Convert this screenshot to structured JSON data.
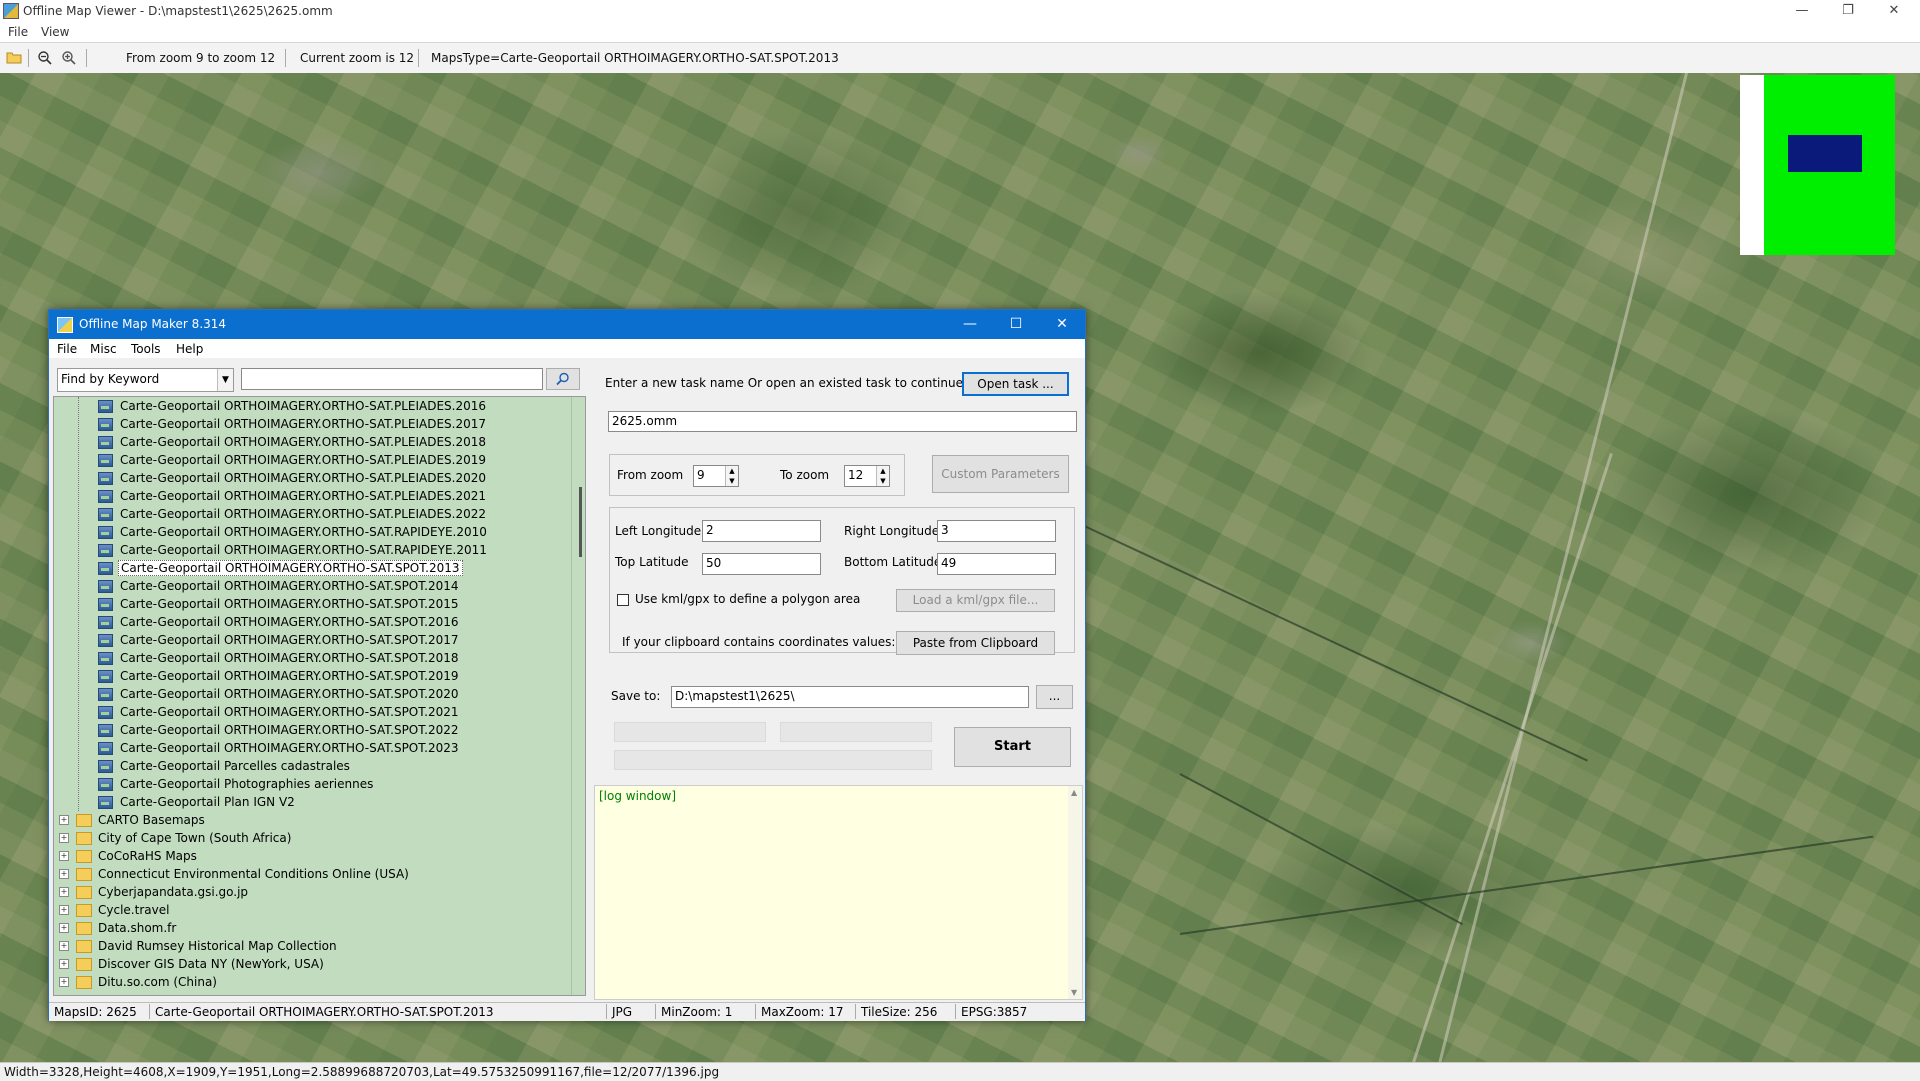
{
  "window": {
    "title": "Offline Map Viewer - D:\\mapstest1\\2625\\2625.omm",
    "minimize": "—",
    "maximize": "❐",
    "close": "✕"
  },
  "menubar": {
    "file": "File",
    "view": "View"
  },
  "toolbar": {
    "zoom_range": "From zoom 9 to zoom 12",
    "current_zoom": "Current zoom is 12",
    "maps_type": "MapsType=Carte-Geoportail ORTHOIMAGERY.ORTHO-SAT.SPOT.2013"
  },
  "statusbar": {
    "text": "Width=3328,Height=4608,X=1909,Y=1951,Long=2.58899688720703,Lat=49.5753250991167,file=12/2077/1396.jpg"
  },
  "dialog": {
    "title": "Offline Map Maker 8.314",
    "menu": {
      "file": "File",
      "misc": "Misc",
      "tools": "Tools",
      "help": "Help"
    },
    "search_mode": "Find by Keyword",
    "search_value": "",
    "tree_leaves": [
      "Carte-Geoportail ORTHOIMAGERY.ORTHO-SAT.PLEIADES.2016",
      "Carte-Geoportail ORTHOIMAGERY.ORTHO-SAT.PLEIADES.2017",
      "Carte-Geoportail ORTHOIMAGERY.ORTHO-SAT.PLEIADES.2018",
      "Carte-Geoportail ORTHOIMAGERY.ORTHO-SAT.PLEIADES.2019",
      "Carte-Geoportail ORTHOIMAGERY.ORTHO-SAT.PLEIADES.2020",
      "Carte-Geoportail ORTHOIMAGERY.ORTHO-SAT.PLEIADES.2021",
      "Carte-Geoportail ORTHOIMAGERY.ORTHO-SAT.PLEIADES.2022",
      "Carte-Geoportail ORTHOIMAGERY.ORTHO-SAT.RAPIDEYE.2010",
      "Carte-Geoportail ORTHOIMAGERY.ORTHO-SAT.RAPIDEYE.2011",
      "Carte-Geoportail ORTHOIMAGERY.ORTHO-SAT.SPOT.2013",
      "Carte-Geoportail ORTHOIMAGERY.ORTHO-SAT.SPOT.2014",
      "Carte-Geoportail ORTHOIMAGERY.ORTHO-SAT.SPOT.2015",
      "Carte-Geoportail ORTHOIMAGERY.ORTHO-SAT.SPOT.2016",
      "Carte-Geoportail ORTHOIMAGERY.ORTHO-SAT.SPOT.2017",
      "Carte-Geoportail ORTHOIMAGERY.ORTHO-SAT.SPOT.2018",
      "Carte-Geoportail ORTHOIMAGERY.ORTHO-SAT.SPOT.2019",
      "Carte-Geoportail ORTHOIMAGERY.ORTHO-SAT.SPOT.2020",
      "Carte-Geoportail ORTHOIMAGERY.ORTHO-SAT.SPOT.2021",
      "Carte-Geoportail ORTHOIMAGERY.ORTHO-SAT.SPOT.2022",
      "Carte-Geoportail ORTHOIMAGERY.ORTHO-SAT.SPOT.2023",
      "Carte-Geoportail Parcelles cadastrales",
      "Carte-Geoportail Photographies aeriennes",
      "Carte-Geoportail Plan IGN V2"
    ],
    "tree_selected": "Carte-Geoportail ORTHOIMAGERY.ORTHO-SAT.SPOT.2013",
    "tree_folders": [
      "CARTO Basemaps",
      "City of Cape Town (South Africa)",
      "CoCoRaHS Maps",
      "Connecticut Environmental Conditions Online (USA)",
      "Cyberjapandata.gsi.go.jp",
      "Cycle.travel",
      "Data.shom.fr",
      "David Rumsey Historical Map Collection",
      "Discover GIS Data NY (NewYork, USA)",
      "Ditu.so.com (China)"
    ],
    "task_prompt": "Enter a new task name Or open an existed task to continue:",
    "open_task_label": "Open task ...",
    "task_name": "2625.omm",
    "from_zoom_label": "From zoom",
    "from_zoom": "9",
    "to_zoom_label": "To zoom",
    "to_zoom": "12",
    "custom_params_label": "Custom Parameters",
    "left_lon_label": "Left Longitude",
    "left_lon": "2",
    "right_lon_label": "Right Longitude",
    "right_lon": "3",
    "top_lat_label": "Top Latitude",
    "top_lat": "50",
    "bottom_lat_label": "Bottom Latitude",
    "bottom_lat": "49",
    "kml_label": "Use kml/gpx to define a polygon area",
    "load_kml_label": "Load a kml/gpx file...",
    "clipboard_prompt": "If your clipboard contains coordinates values:",
    "paste_label": "Paste from Clipboard",
    "save_to_label": "Save to:",
    "save_to": "D:\\mapstest1\\2625\\",
    "browse_label": "...",
    "start_label": "Start",
    "log_text": "[log window]",
    "status": {
      "maps_id": "MapsID: 2625",
      "maps_name": "Carte-Geoportail ORTHOIMAGERY.ORTHO-SAT.SPOT.2013",
      "format": "JPG",
      "min_zoom": "MinZoom: 1",
      "max_zoom": "MaxZoom: 17",
      "tile_size": "TileSize: 256",
      "epsg": "EPSG:3857"
    }
  },
  "colors": {
    "accent": "#0b6fd0",
    "tree_bg": "#c1dcbf",
    "log_bg": "#ffffe1",
    "overview_green": "#00ee00",
    "overview_viewport": "#0a1a7a"
  }
}
